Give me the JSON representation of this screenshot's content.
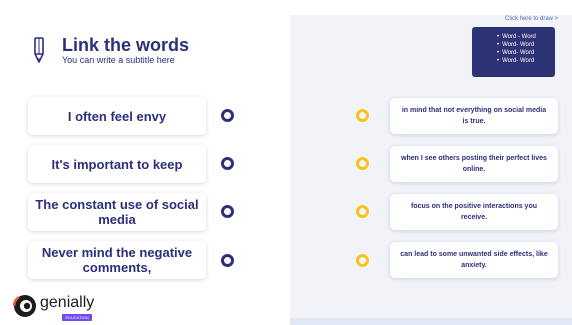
{
  "header": {
    "title": "Link the words",
    "subtitle": "You can write a subtitle here",
    "icon": "pencil-icon"
  },
  "hint": {
    "link_label": "Click here to draw >",
    "items": [
      "Word - Word",
      "Word- Word",
      "Word- Word",
      "Word- Word"
    ]
  },
  "left_items": [
    {
      "label": "I often feel envy"
    },
    {
      "label": "It's important to keep"
    },
    {
      "label": "The constant use of social media"
    },
    {
      "label": "Never mind the negative comments,"
    }
  ],
  "right_items": [
    {
      "label": "in mind that not everything on social media is true."
    },
    {
      "label": "when I see others posting their perfect lives online."
    },
    {
      "label": "focus on the positive interactions you receive."
    },
    {
      "label": "can lead to some unwanted side effects, like anxiety."
    }
  ],
  "brand": {
    "logo_text": "genially",
    "badge": "EDUCATION"
  },
  "colors": {
    "navy": "#2c2f7a",
    "yellow": "#f5c518",
    "panel": "#f1f3f9",
    "hint_box": "#2d3176",
    "badge": "#6f4cf2"
  }
}
